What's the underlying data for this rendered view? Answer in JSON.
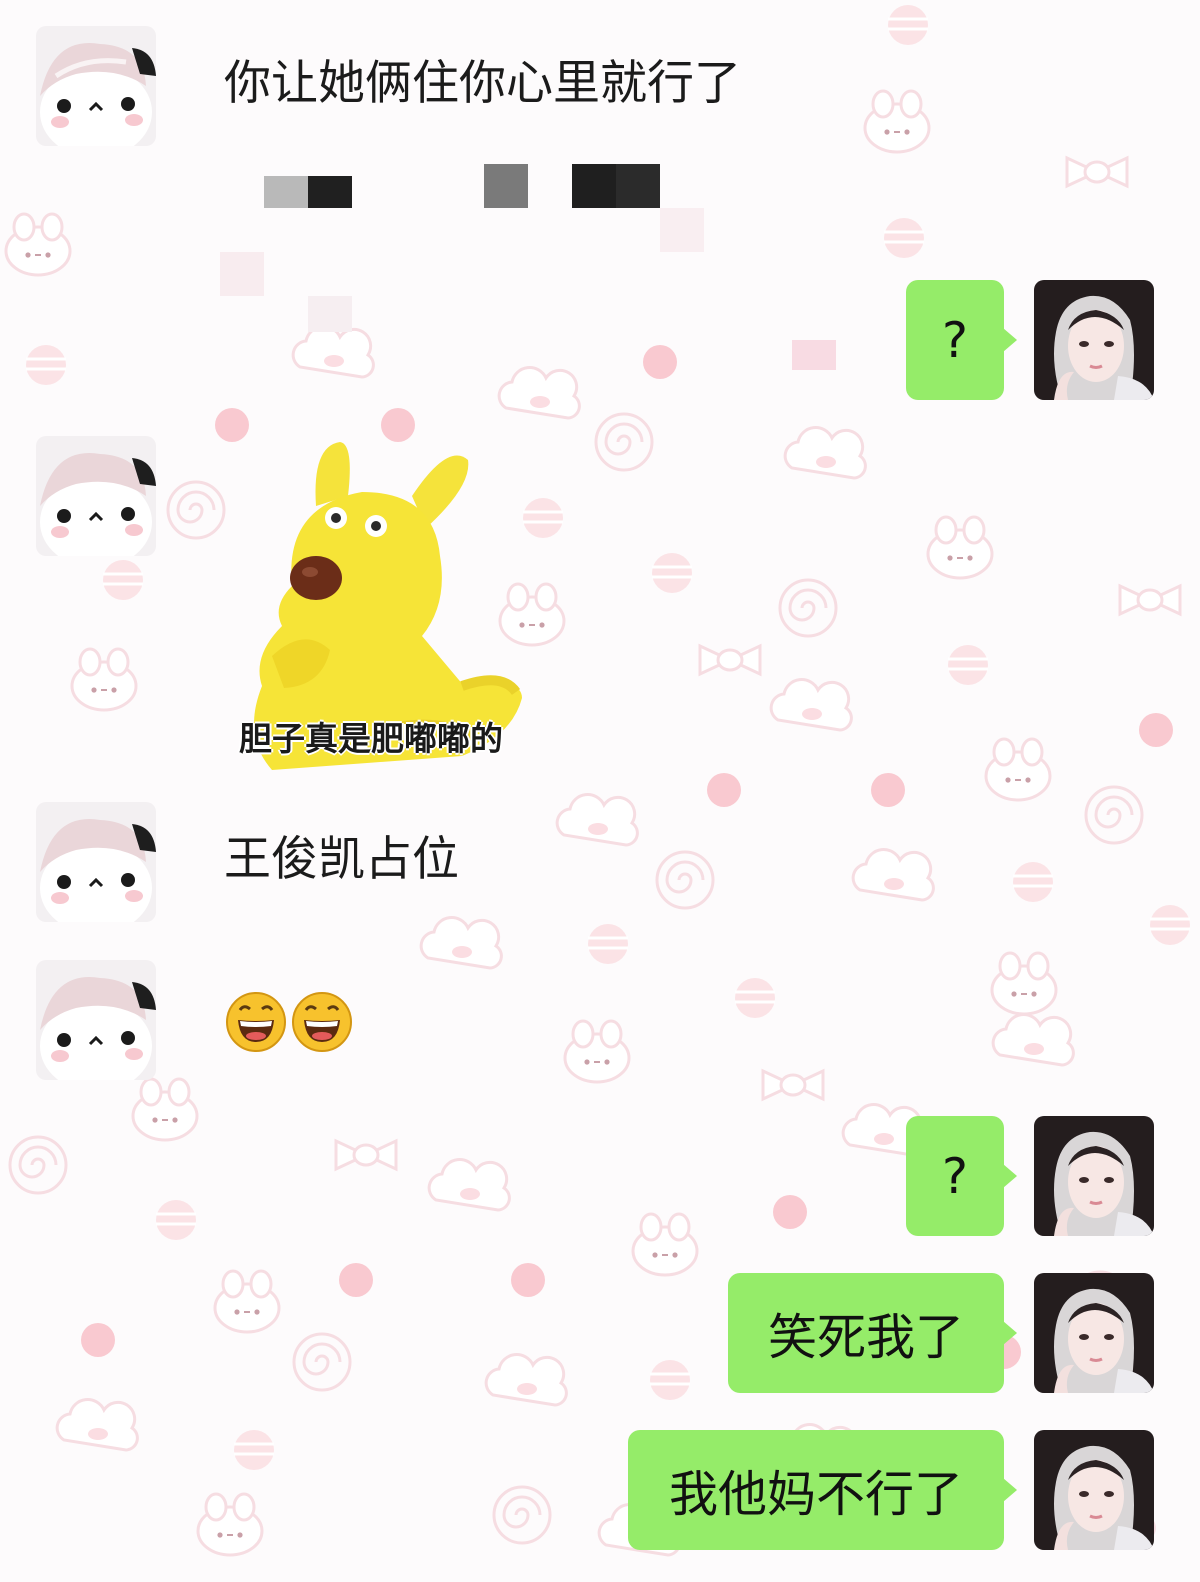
{
  "colors": {
    "background": "#fdfbfc",
    "sent_bubble": "#95ec69",
    "text": "#1b1b1b"
  },
  "messages": [
    {
      "side": "left",
      "type": "text",
      "text": "你让她俩住你心里就行了",
      "avatar_icon": "panda-avatar-icon"
    },
    {
      "side": "right",
      "type": "text",
      "text": "?",
      "avatar_icon": "girl-avatar-icon"
    },
    {
      "side": "left",
      "type": "sticker",
      "caption": "胆子真是肥嘟嘟的",
      "icon": "yellow-dog-sticker-icon",
      "avatar_icon": "panda-avatar-icon"
    },
    {
      "side": "left",
      "type": "text",
      "text": "王俊凯占位",
      "avatar_icon": "panda-avatar-icon"
    },
    {
      "side": "left",
      "type": "emoji",
      "icons": [
        "grinning-face-icon",
        "grinning-face-icon"
      ],
      "avatar_icon": "panda-avatar-icon"
    },
    {
      "side": "right",
      "type": "text",
      "text": "?",
      "avatar_icon": "girl-avatar-icon"
    },
    {
      "side": "right",
      "type": "text",
      "text": "笑死我了",
      "avatar_icon": "girl-avatar-icon"
    },
    {
      "side": "right",
      "type": "text",
      "text": "我他妈不行了",
      "avatar_icon": "girl-avatar-icon"
    }
  ]
}
